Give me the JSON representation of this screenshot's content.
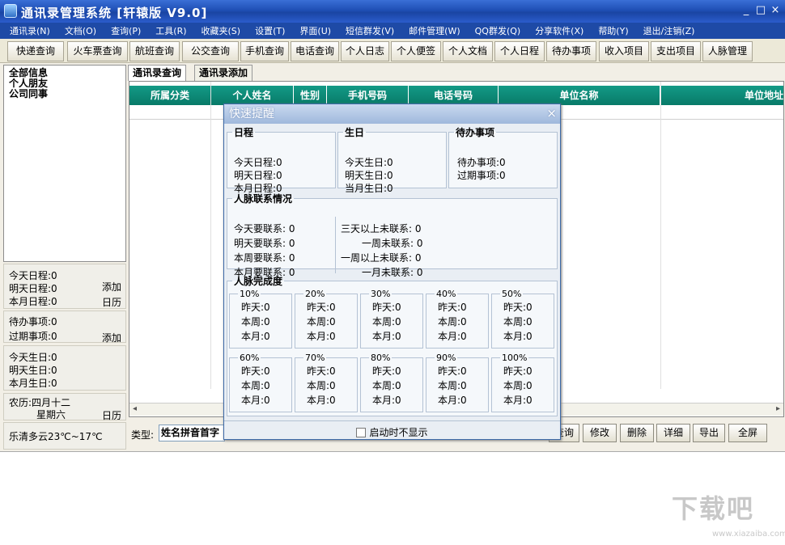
{
  "window": {
    "title": "通讯录管理系统 [轩辕版 V9.0]",
    "min": "_",
    "max": "□",
    "close": "×"
  },
  "menu": [
    "通讯录(N)",
    "文档(O)",
    "查询(P)",
    "工具(R)",
    "收藏夹(S)",
    "设置(T)",
    "界面(U)",
    "短信群发(V)",
    "邮件管理(W)",
    "QQ群发(Q)",
    "分享软件(X)",
    "帮助(Y)",
    "退出/注销(Z)"
  ],
  "toolbar": [
    "快递查询",
    "火车票查询",
    "航班查询",
    "公交查询",
    "手机查询",
    "电话查询",
    "个人日志",
    "个人便签",
    "个人文档",
    "个人日程",
    "待办事项",
    "收入项目",
    "支出项目",
    "人脉管理"
  ],
  "tree": [
    "全部信息",
    "个人朋友",
    "公司同事"
  ],
  "left_panels": {
    "schedule": {
      "today": "今天日程:0",
      "tomorrow": "明天日程:0",
      "month": "本月日程:0",
      "add": "添加",
      "calendar": "日历"
    },
    "todo": {
      "pending": "待办事项:0",
      "overdue": "过期事项:0",
      "add": "添加"
    },
    "birthday": {
      "today": "今天生日:0",
      "tomorrow": "明天生日:0",
      "month": "本月生日:0"
    },
    "lunar": {
      "date": "农历:四月十二",
      "weekday": "星期六",
      "calendar": "日历"
    },
    "weather": "乐清多云23℃~17℃"
  },
  "subtabs": [
    "通讯录查询",
    "通讯录添加"
  ],
  "grid_headers": [
    "所属分类",
    "个人姓名",
    "性别",
    "手机号码",
    "电话号码",
    "单位名称",
    "单位地址"
  ],
  "bottom": {
    "type_label": "类型:",
    "type_value": "姓名拼音首字",
    "buttons": [
      "查询",
      "修改",
      "删除",
      "详细",
      "导出",
      "全屏"
    ]
  },
  "dialog": {
    "title": "快速提醒",
    "close": "×",
    "schedule": {
      "legend": "日程",
      "today": "今天日程:0",
      "tomorrow": "明天日程:0",
      "month": "本月日程:0"
    },
    "birthday": {
      "legend": "生日",
      "today": "今天生日:0",
      "tomorrow": "明天生日:0",
      "month": "当月生日:0"
    },
    "todo": {
      "legend": "待办事项",
      "pending": "待办事项:0",
      "overdue": "过期事项:0"
    },
    "contacts": {
      "legend": "人脉联系情况",
      "left": [
        "今天要联系: 0",
        "明天要联系: 0",
        "本周要联系: 0",
        "本月要联系: 0"
      ],
      "right": [
        "三天以上未联系: 0",
        "一周未联系: 0",
        "一周以上未联系: 0",
        "一月未联系: 0"
      ]
    },
    "completion": {
      "legend": "人脉完成度",
      "levels": [
        "10%",
        "20%",
        "30%",
        "40%",
        "50%",
        "60%",
        "70%",
        "80%",
        "90%",
        "100%"
      ],
      "yesterday": "昨天:0",
      "week": "本周:0",
      "month": "本月:0"
    },
    "footer": "启动时不显示"
  },
  "watermark": "下载吧",
  "watermark_url": "www.xiazaiba.com"
}
